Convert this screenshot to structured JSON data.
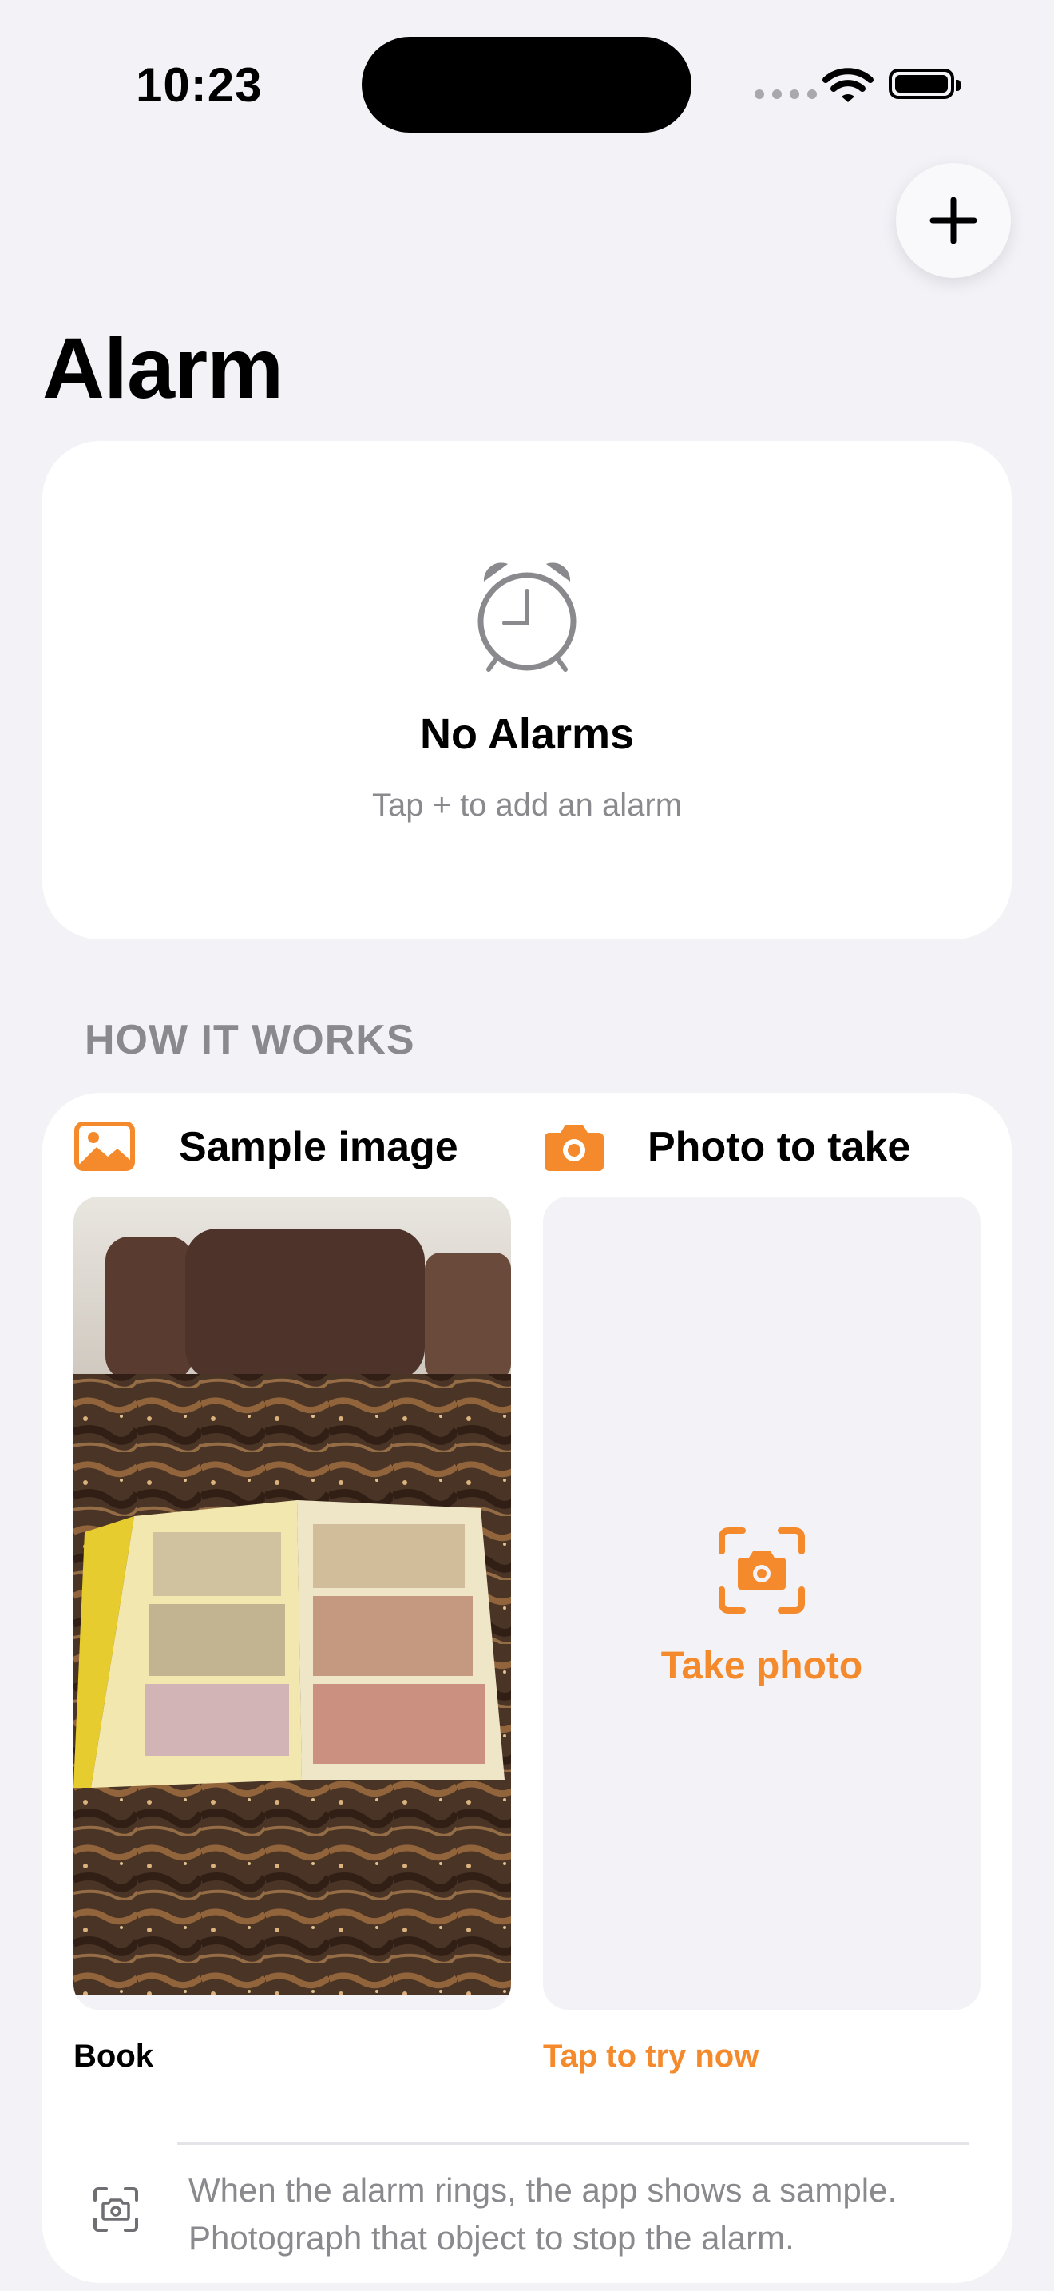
{
  "status_bar": {
    "time": "10:23"
  },
  "header": {
    "title": "Alarm",
    "add_button_icon": "plus-icon"
  },
  "empty_state": {
    "icon": "alarm-clock-icon",
    "title": "No Alarms",
    "subtitle": "Tap + to add an alarm"
  },
  "how_it_works": {
    "section_title": "HOW IT WORKS",
    "sample": {
      "icon": "photo-icon",
      "title": "Sample image",
      "caption": "Book",
      "image_description": "Open comic book on a granite table"
    },
    "capture": {
      "icon": "camera-icon",
      "title": "Photo to take",
      "action_label": "Take photo",
      "caption": "Tap to try now"
    },
    "hint": {
      "icon": "camera-viewfinder-icon",
      "text": "When the alarm rings, the app shows a sample. Photograph that object to stop the alarm."
    }
  },
  "colors": {
    "accent": "#f48a2c",
    "background": "#f2f2f7",
    "secondary_text": "#8a8a8e"
  }
}
